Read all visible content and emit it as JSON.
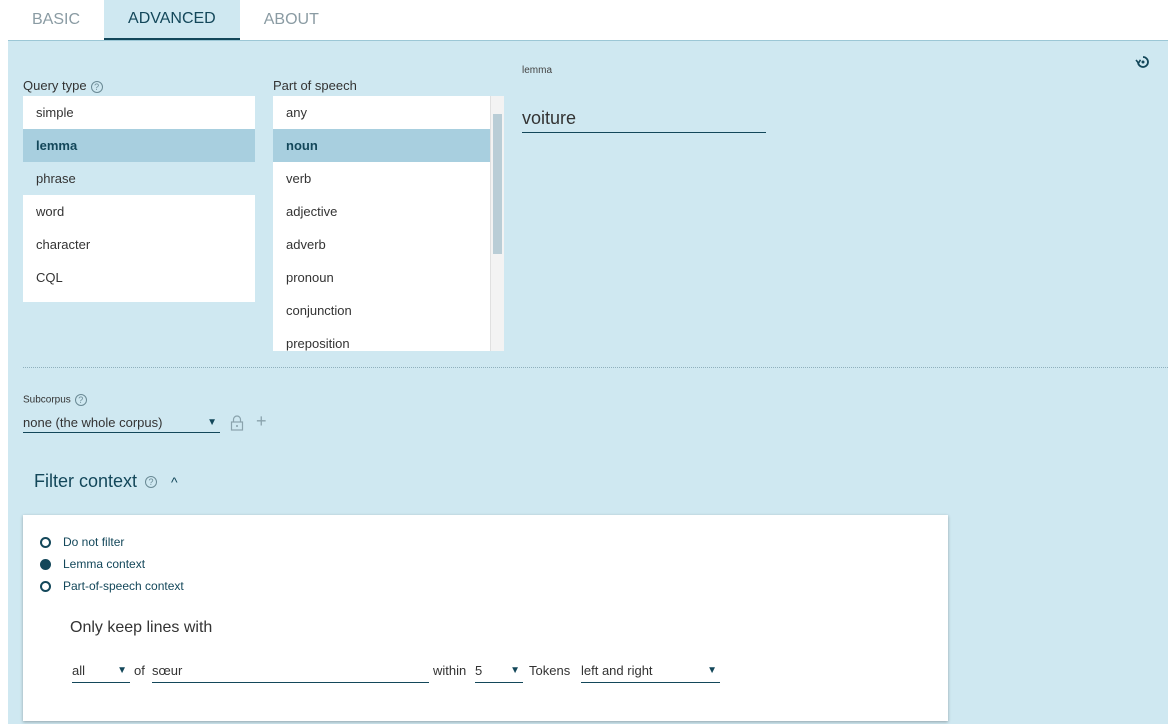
{
  "tabs": [
    {
      "label": "BASIC"
    },
    {
      "label": "ADVANCED"
    },
    {
      "label": "ABOUT"
    }
  ],
  "query_type": {
    "label": "Query type",
    "items": [
      "simple",
      "lemma",
      "phrase",
      "word",
      "character",
      "CQL"
    ],
    "selected": "lemma"
  },
  "part_of_speech": {
    "label": "Part of speech",
    "items": [
      "any",
      "noun",
      "verb",
      "adjective",
      "adverb",
      "pronoun",
      "conjunction",
      "preposition"
    ],
    "selected": "noun"
  },
  "lemma": {
    "label": "lemma",
    "value": "voiture"
  },
  "subcorpus": {
    "label": "Subcorpus",
    "value": "none (the whole corpus)"
  },
  "filter": {
    "title": "Filter context",
    "options": [
      "Do not filter",
      "Lemma context",
      "Part-of-speech context"
    ],
    "selected": "Lemma context",
    "heading": "Only keep lines with",
    "quantifier": "all",
    "of_label": "of",
    "word": "sœur",
    "within_label": "within",
    "window": "5",
    "tokens_label": "Tokens",
    "direction": "left and right"
  },
  "icons": {
    "help": "?",
    "caret": "▼",
    "chevron_up": "^",
    "plus": "+"
  }
}
